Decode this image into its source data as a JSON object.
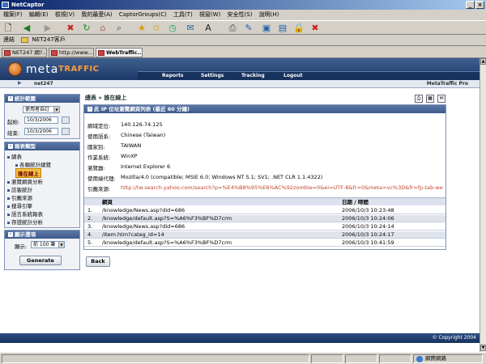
{
  "window": {
    "title": "NetCaptor"
  },
  "menu": [
    "檔案(F)",
    "編輯(E)",
    "檢視(V)",
    "我的最愛(A)",
    "CaptorGroups(C)",
    "工具(T)",
    "視窗(W)",
    "安全性(S)",
    "說明(H)"
  ],
  "links": {
    "label": "連結",
    "item": "NET247客戶"
  },
  "tabs": [
    "NET247 網?...",
    "http://www...",
    "WebTraffic..."
  ],
  "site": {
    "logo_meta": "meta",
    "logo_traffic": "TRAFFIC",
    "nav": [
      "Reports",
      "Settings",
      "Tracking",
      "Logout"
    ],
    "domain": "net247",
    "brand": "MetaTraffic Pro"
  },
  "left": {
    "stats_title": "統計範圍",
    "range_value": "使用者自訂",
    "start_label": "起始:",
    "start_value": "10/3/2006",
    "end_label": "結束:",
    "end_value": "10/3/2006",
    "report_title": "報表類型",
    "nav": [
      {
        "label": "總表",
        "level": 0
      },
      {
        "label": "各類統計總覽",
        "level": 1
      },
      {
        "label": "誰在線上",
        "level": 1,
        "current": true
      },
      {
        "label": "瀏覽網頁分析",
        "level": 0
      },
      {
        "label": "訪客統計",
        "level": 0
      },
      {
        "label": "引薦來源",
        "level": 0
      },
      {
        "label": "搜尋引擎",
        "level": 0
      },
      {
        "label": "語言系統報表",
        "level": 0
      },
      {
        "label": "存證統計分析",
        "level": 0
      }
    ],
    "display_title": "顯示選項",
    "show_label": "顯示:",
    "show_value": "前 100 筆",
    "generate": "Generate"
  },
  "main": {
    "breadcrumb": "總表 » 誰在線上",
    "box_title": "此 IP 位址瀏覽網頁列表 (最近 60 分鐘)",
    "info": [
      {
        "key": "網域定位:",
        "value": "140.126.74.125"
      },
      {
        "key": "使用語系:",
        "value": "Chinese (Taiwan)"
      },
      {
        "key": "國家別:",
        "value": "TAIWAN"
      },
      {
        "key": "作業系統:",
        "value": "WinXP"
      },
      {
        "key": "瀏覽器:",
        "value": "Internet Explorer 6"
      },
      {
        "key": "使用端代理:",
        "value": "Mozilla/4.0 (compatible; MSIE 6.0; Windows NT 5.1; SV1; .NET CLR 1.1.4322)"
      },
      {
        "key": "引薦來源:",
        "value": "http://tw.search.yahoo.com/search?p=%E4%B8%95%E6%AC%92zombie=0&ei=UTF-8&fr=0&meta=vc%3D&fr=fp-tab-web-t"
      }
    ],
    "col_page": "網頁",
    "col_time": "日期 / 時間",
    "rows": [
      {
        "n": "1.",
        "page": "/knowledge/News.asp?did=686",
        "time": "2006/10/3 10:23:48"
      },
      {
        "n": "2.",
        "page": "/knowledge/default.asp?S=%A6%F3%BF%D7crm",
        "time": "2006/10/3 10:24:06"
      },
      {
        "n": "3.",
        "page": "/knowledge/News.asp?did=686",
        "time": "2006/10/3 10:24:14"
      },
      {
        "n": "4.",
        "page": "/Item.htm?categ_id=14",
        "time": "2006/10/3 10:24:17"
      },
      {
        "n": "5.",
        "page": "/knowledge/default.asp?S=%A6%F3%BF%D7crm",
        "time": "2006/10/3 10:41:59"
      }
    ],
    "back": "Back"
  },
  "footer": "© Copyright 2004",
  "status": {
    "zone": "網際網路"
  }
}
